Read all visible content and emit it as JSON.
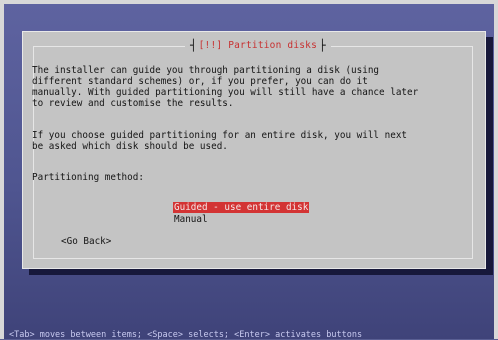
{
  "dialog": {
    "title": "[!!] Partition disks",
    "paragraph1_line1": "The installer can guide you through partitioning a disk (using",
    "paragraph1_line2": "different standard schemes) or, if you prefer, you can do it",
    "paragraph1_line3": "manually. With guided partitioning you will still have a chance later",
    "paragraph1_line4": "to review and customise the results.",
    "paragraph2_line1": "If you choose guided partitioning for an entire disk, you will next",
    "paragraph2_line2": "be asked which disk should be used.",
    "method_label": "Partitioning method:",
    "options": [
      "Guided - use entire disk",
      "Manual"
    ],
    "selected_option": "Guided - use entire disk",
    "go_back_label": "<Go Back>"
  },
  "status_bar": {
    "text": "<Tab> moves between items; <Space> selects; <Enter> activates buttons"
  },
  "colors": {
    "background": "#5a5f93",
    "dialog": "#c4c4c4",
    "highlight": "#d33434",
    "title": "#c73030"
  }
}
